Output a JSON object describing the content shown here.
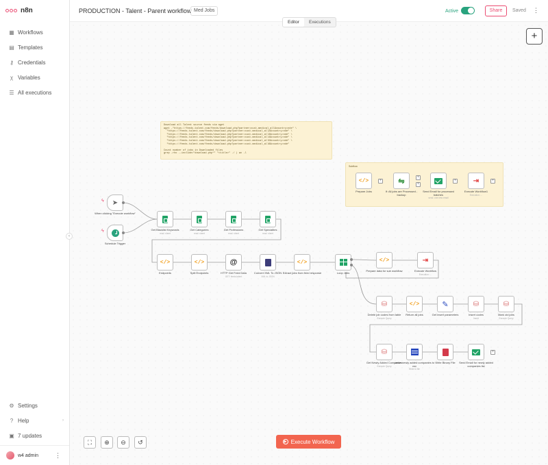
{
  "app": {
    "logo_text": "n8n"
  },
  "sidebar": {
    "items": [
      {
        "icon": "workflows-icon",
        "label": "Workflows"
      },
      {
        "icon": "templates-icon",
        "label": "Templates"
      },
      {
        "icon": "key-icon",
        "label": "Credentials"
      },
      {
        "icon": "variables-icon",
        "label": "Variables"
      },
      {
        "icon": "list-icon",
        "label": "All executions"
      }
    ],
    "bottom": [
      {
        "icon": "gear-icon",
        "label": "Settings"
      },
      {
        "icon": "help-icon",
        "label": "Help"
      },
      {
        "icon": "gift-icon",
        "label": "7 updates"
      }
    ],
    "user": "w4 admin"
  },
  "header": {
    "workflow_name": "PRODUCTION - Talent - Parent workflow",
    "tag": "Med Jobs",
    "active_label": "Active",
    "active": true,
    "share": "Share",
    "saved": "Saved",
    "tabs": [
      "Editor",
      "Executions"
    ],
    "active_tab": "Editor"
  },
  "notes": {
    "main": "Download all Talent source feeds via wget\nwget -\"https://feeds.talent.com/feeds/download.php?partner=cust-medical_all&country=nde\" \\\n  \"https://feeds.talent.com/feeds/download.php?partner=cust-medical_all2&country=nde\" \\\n  \"https://feeds.talent.com/feeds/download.php?partner=cust-medical_all3&country=nde\" \\\n  \"https://feeds.talent.com/feeds/download.php?partner=cust-medical_all4&country=nde\" \\\n  \"https://feeds.talent.com/feeds/download.php?partner=cust-medical_all5&country=nde\" \\\n  \"https://feeds.talent.com/feeds/download.php?partner=cust-medical_all6&country=nde\"\n\nCount number of jobs in Downloaded files\ngrep -rho --include=\"download.php*\" \"<title>\" ./ | wc -l",
    "subflow_title": "Subflow"
  },
  "nodes": [
    {
      "id": "manual",
      "label": "When clicking \"Execute workflow\"",
      "sub": "",
      "glyph": "cursor"
    },
    {
      "id": "schedule",
      "label": "Schedule Trigger",
      "sub": "",
      "glyph": "clock"
    },
    {
      "id": "blacklist",
      "label": "Get Blacklist Keywords",
      "sub": "read: sheet",
      "glyph": "sheet"
    },
    {
      "id": "categories",
      "label": "Get Categories",
      "sub": "read: sheet",
      "glyph": "sheet"
    },
    {
      "id": "professions",
      "label": "Get Professions",
      "sub": "read: sheet",
      "glyph": "sheet"
    },
    {
      "id": "specialties",
      "label": "Get Specialties",
      "sub": "read: sheet",
      "glyph": "sheet"
    },
    {
      "id": "endpoints",
      "label": "Endpoints",
      "sub": "",
      "glyph": "code"
    },
    {
      "id": "split",
      "label": "Split Endpoints",
      "sub": "",
      "glyph": "code"
    },
    {
      "id": "http",
      "label": "HTTP Get Feed Data",
      "sub": "GET: feeds.talent",
      "glyph": "at"
    },
    {
      "id": "xml",
      "label": "Convert XML To JSON",
      "sub": "XML to JSON",
      "glyph": "doc"
    },
    {
      "id": "extract",
      "label": "Extract jobs from feed response",
      "sub": "",
      "glyph": "code"
    },
    {
      "id": "loop",
      "label": "Loop Jobs",
      "sub": "",
      "glyph": "grid"
    },
    {
      "id": "prepare",
      "label": "Prepare data for sub workflow",
      "sub": "",
      "glyph": "code"
    },
    {
      "id": "execwf",
      "label": "Execute Workflow",
      "sub": "Execution: ...",
      "glyph": "exec"
    },
    {
      "id": "sf_prepare",
      "label": "Prepare Jobs",
      "sub": "",
      "glyph": "code"
    },
    {
      "id": "sf_if",
      "label": "If: All jobs are Processed - backup",
      "sub": "",
      "glyph": "filter"
    },
    {
      "id": "sf_email",
      "label": "Send Email for processed batches",
      "sub": "send: one new email",
      "glyph": "mail"
    },
    {
      "id": "sf_exec",
      "label": "Execute Workflow1",
      "sub": "Execution: ...",
      "glyph": "exec"
    },
    {
      "id": "delete",
      "label": "Delete job codes from table",
      "sub": "Execute Query",
      "glyph": "db"
    },
    {
      "id": "return",
      "label": "Return all jobs",
      "sub": "",
      "glyph": "code"
    },
    {
      "id": "insertp",
      "label": "Get insert parameters",
      "sub": "",
      "glyph": "pen"
    },
    {
      "id": "insert",
      "label": "Insert codes",
      "sub": "Insert",
      "glyph": "db"
    },
    {
      "id": "mark",
      "label": "Mark old jobs",
      "sub": "Execute Query",
      "glyph": "db"
    },
    {
      "id": "newly",
      "label": "Get Newly Added Companies",
      "sub": "Execute Query",
      "glyph": "db"
    },
    {
      "id": "arrive",
      "label": "arrive newly added companies to csv",
      "sub": "Write to file",
      "glyph": "table"
    },
    {
      "id": "binary",
      "label": "Write Binary File",
      "sub": "",
      "glyph": "file"
    },
    {
      "id": "sendmail",
      "label": "Send Email for newly added companies list",
      "sub": "",
      "glyph": "mail"
    }
  ],
  "controls": {
    "fit": "fit-view-icon",
    "zoom_in": "zoom-in-icon",
    "zoom_out": "zoom-out-icon",
    "reset": "reset-icon",
    "execute": "Execute Workflow"
  },
  "colors": {
    "brand": "#ea4b71",
    "active": "#29a37e",
    "execute": "#f2654f",
    "note": "#fcf2d4"
  }
}
